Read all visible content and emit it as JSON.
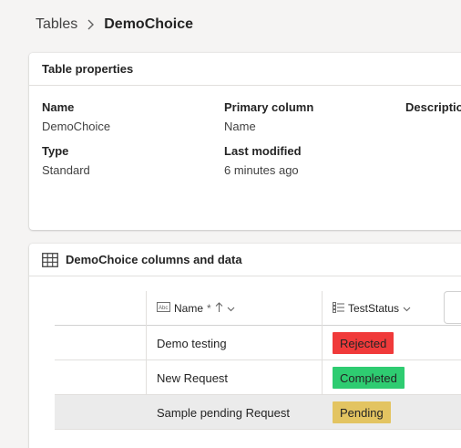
{
  "breadcrumb": {
    "root": "Tables",
    "current": "DemoChoice"
  },
  "properties": {
    "title": "Table properties",
    "name_label": "Name",
    "name_value": "DemoChoice",
    "primary_label": "Primary column",
    "primary_value": "Name",
    "description_label": "Description",
    "type_label": "Type",
    "type_value": "Standard",
    "modified_label": "Last modified",
    "modified_value": "6 minutes ago"
  },
  "data_section": {
    "title": "DemoChoice columns and data",
    "columns": [
      {
        "label": "Name",
        "required": "*",
        "icon": "text-column-icon",
        "sort": "ascending"
      },
      {
        "label": "TestStatus",
        "icon": "choice-column-icon"
      }
    ],
    "rows": [
      {
        "name": "Demo testing",
        "status": "Rejected",
        "status_color": "#f03a3a",
        "selected": false
      },
      {
        "name": "New Request",
        "status": "Completed",
        "status_color": "#2ecc71",
        "selected": false
      },
      {
        "name": "Sample pending Request",
        "status": "Pending",
        "status_color": "#e3c461",
        "selected": true
      }
    ]
  }
}
